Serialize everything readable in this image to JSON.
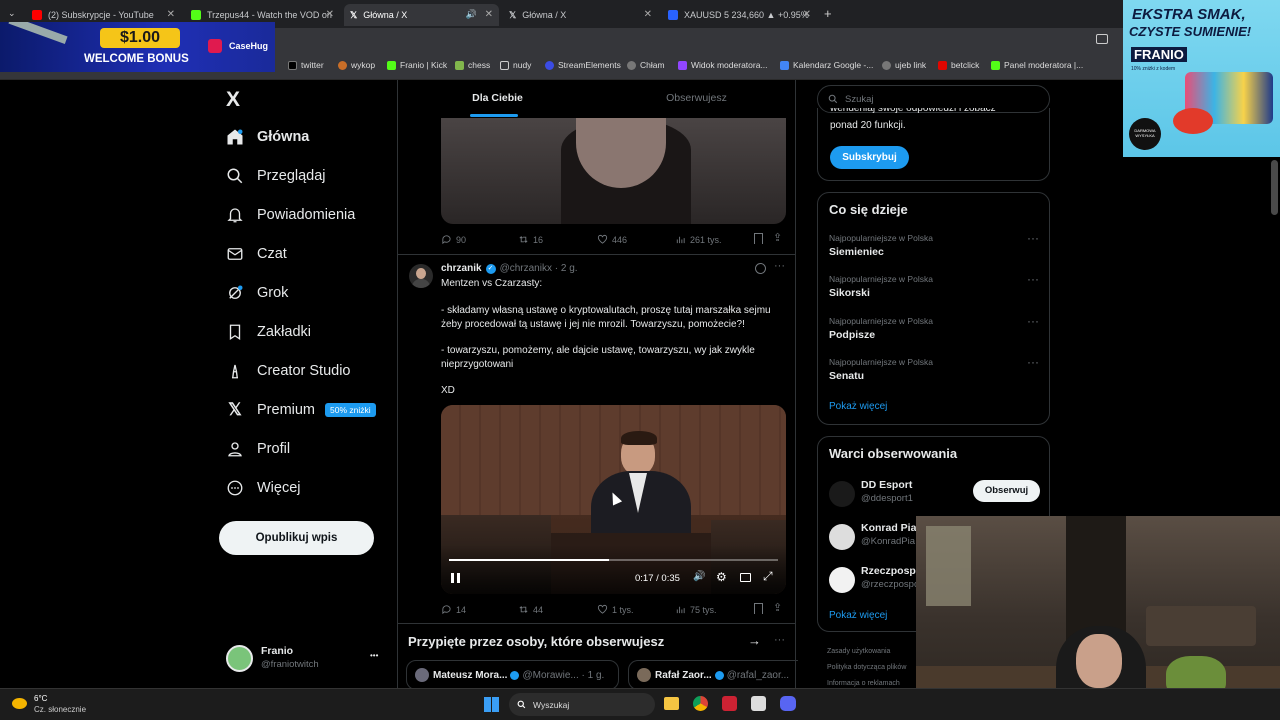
{
  "browser": {
    "tabs": [
      {
        "label": "(2) Subskrypcje - YouTube",
        "fav": "#ff0000"
      },
      {
        "label": "Trzepus44 - Watch the VOD on",
        "fav": "#53fc18"
      },
      {
        "label": "Główna / X",
        "fav": "#111111"
      },
      {
        "label": "Główna / X",
        "fav": "#111111"
      },
      {
        "label": "XAUUSD 5 234,660 ▲ +0.95%",
        "fav": "#2962ff"
      }
    ],
    "new_tab": "+",
    "bookmarks": [
      "twitter",
      "wykop",
      "Franio | Kick",
      "chess",
      "nudy",
      "StreamElements",
      "Chłam",
      "Widok moderatora...",
      "Kalendarz Google -...",
      "ujeb link",
      "betclick",
      "Panel moderatora |..."
    ]
  },
  "overlay": {
    "ad_amount": "$1.00",
    "ad_text": "WELCOME BONUS",
    "ad_brand": "CaseHug",
    "promo_line1": "EKSTRA SMAK,",
    "promo_line2": "CZYSTE SUMIENIE!",
    "promo_brand": "FRANIO",
    "promo_sub": "10% zniżki z kodem",
    "promo_badge": "DARMOWA WYSYŁKA"
  },
  "sidebar": {
    "logo": "X",
    "items": [
      {
        "label": "Główna",
        "icon": "home-icon"
      },
      {
        "label": "Przeglądaj",
        "icon": "search-icon"
      },
      {
        "label": "Powiadomienia",
        "icon": "bell-icon"
      },
      {
        "label": "Czat",
        "icon": "mail-icon"
      },
      {
        "label": "Grok",
        "icon": "grok-icon"
      },
      {
        "label": "Zakładki",
        "icon": "bookmark-icon"
      },
      {
        "label": "Creator Studio",
        "icon": "creator-icon"
      },
      {
        "label": "Premium",
        "icon": "x-icon"
      },
      {
        "label": "Profil",
        "icon": "person-icon"
      },
      {
        "label": "Więcej",
        "icon": "more-icon"
      }
    ],
    "premium_badge": "50% zniżki",
    "post_button": "Opublikuj wpis",
    "account": {
      "name": "Franio",
      "handle": "@franiotwitch",
      "more": "•••"
    }
  },
  "feed": {
    "tabs": {
      "for_you": "Dla Ciebie",
      "following": "Obserwujesz"
    },
    "prev_tweet": {
      "replies": "90",
      "reposts": "16",
      "likes": "446",
      "views": "261 tys."
    },
    "tweet": {
      "name": "chrzanik",
      "handle": "@chrzanikx · 2 g.",
      "line1": "Mentzen vs Czarzasty:",
      "line2": "- składamy własną ustawę o kryptowalutach, proszę tutaj marszałka sejmu żeby procedował tą ustawę i jej nie mrozil. Towarzyszu, pomożecie?!",
      "line3": "- towarzyszu, pomożemy, ale dajcie ustawę, towarzyszu, wy jak zwykle nieprzygotowani",
      "line4": "XD",
      "video_time": "0:17 / 0:35",
      "video_progress": 0.486,
      "replies": "14",
      "reposts": "44",
      "likes": "1 tys.",
      "views": "75 tys."
    },
    "pinned": {
      "title": "Przypięte przez osoby, które obserwujesz",
      "items": [
        {
          "name": "Mateusz Mora...",
          "handle": "@Morawie... · 1 g."
        },
        {
          "name": "Rafał Zaor...",
          "handle": "@rafal_zaor..."
        }
      ]
    }
  },
  "right": {
    "search_placeholder": "Szukaj",
    "premium_text_top": "wendeniaj swoje odpowiedzi i zobacz",
    "premium_text": "ponad 20 funkcji.",
    "subscribe": "Subskrybuj",
    "trending_title": "Co się dzieje",
    "trends": [
      {
        "cat": "Najpopularniejsze w Polska",
        "name": "Siemieniec"
      },
      {
        "cat": "Najpopularniejsze w Polska",
        "name": "Sikorski"
      },
      {
        "cat": "Najpopularniejsze w Polska",
        "name": "Podpisze"
      },
      {
        "cat": "Najpopularniejsze w Polska",
        "name": "Senatu"
      }
    ],
    "show_more": "Pokaż więcej",
    "follow_title": "Warci obserwowania",
    "follows": [
      {
        "name": "DD Esport",
        "handle": "@ddesport1"
      },
      {
        "name": "Konrad Pias",
        "handle": "@KonradPia"
      },
      {
        "name": "Rzeczpospo",
        "handle": "@rzeczpospo"
      }
    ],
    "follow_button": "Obserwuj",
    "footer": [
      "Zasady użytkowania",
      "Polityka dotycząca plików",
      "Informacja o reklamach"
    ]
  },
  "taskbar": {
    "temp": "6°C",
    "weather": "Cz. słonecznie",
    "search": "Wyszukaj"
  }
}
